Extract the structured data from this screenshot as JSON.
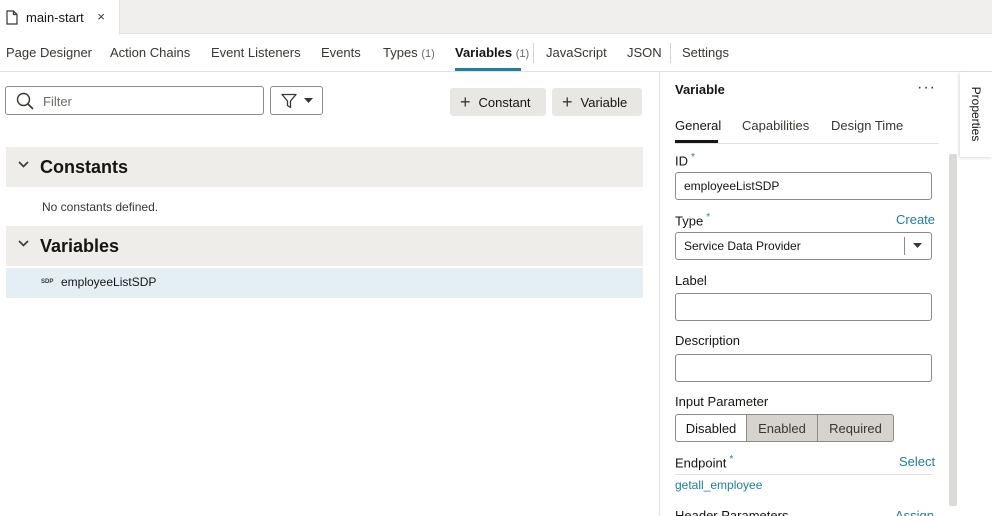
{
  "file_tab": {
    "name": "main-start",
    "close": "×"
  },
  "designer_tabs": [
    {
      "label": "Page Designer",
      "count": ""
    },
    {
      "label": "Action Chains",
      "count": ""
    },
    {
      "label": "Event Listeners",
      "count": ""
    },
    {
      "label": "Events",
      "count": ""
    },
    {
      "label": "Types",
      "count": "(1)"
    },
    {
      "label": "Variables",
      "count": "(1)"
    },
    {
      "label": "JavaScript",
      "count": ""
    },
    {
      "label": "JSON",
      "count": ""
    },
    {
      "label": "Settings",
      "count": ""
    }
  ],
  "active_tab": "Variables",
  "filter": {
    "placeholder": "Filter"
  },
  "buttons": {
    "constant": "Constant",
    "variable": "Variable"
  },
  "sections": {
    "constants": {
      "title": "Constants",
      "empty": "No constants defined."
    },
    "variables": {
      "title": "Variables",
      "items": [
        {
          "badge": "SDP",
          "name": "employeeListSDP"
        }
      ]
    }
  },
  "properties": {
    "title": "Variable",
    "menu": "···",
    "tabs": [
      "General",
      "Capabilities",
      "Design Time"
    ],
    "id_label": "ID",
    "id_value": "employeeListSDP",
    "type_label": "Type",
    "type_link": "Create",
    "type_value": "Service Data Provider",
    "label_label": "Label",
    "label_value": "",
    "description_label": "Description",
    "description_value": "",
    "input_param_label": "Input Parameter",
    "input_param_options": [
      "Disabled",
      "Enabled",
      "Required"
    ],
    "input_param_selected": "Disabled",
    "endpoint_label": "Endpoint",
    "endpoint_link": "Select",
    "endpoint_value": "getall_employee",
    "header_params_label": "Header Parameters",
    "header_params_link": "Assign",
    "required_marker": "*"
  },
  "side_tab": "Properties",
  "colors": {
    "accent": "#227e9e",
    "selected_row": "#e3eff3",
    "section_bg": "#efedea"
  }
}
